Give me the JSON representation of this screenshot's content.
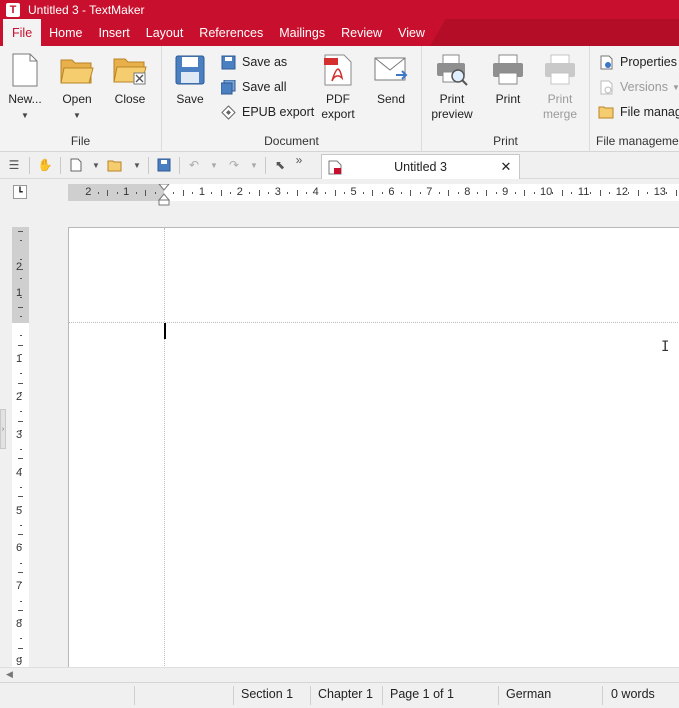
{
  "window": {
    "title": "Untitled 3 - TextMaker",
    "logo_letter": "T"
  },
  "menu_tabs": [
    "File",
    "Home",
    "Insert",
    "Layout",
    "References",
    "Mailings",
    "Review",
    "View"
  ],
  "ribbon": {
    "file": {
      "label": "File",
      "new": "New...",
      "open": "Open",
      "close": "Close"
    },
    "document": {
      "label": "Document",
      "save": "Save",
      "save_as": "Save as",
      "save_all": "Save all",
      "epub_export": "EPUB export",
      "pdf_export": "PDF\nexport",
      "send": "Send"
    },
    "print": {
      "label": "Print",
      "print_preview": "Print\npreview",
      "print": "Print",
      "print_merge": "Print\nmerge"
    },
    "file_management": {
      "label": "File management",
      "properties": "Properties",
      "versions": "Versions",
      "file_manager": "File manag"
    }
  },
  "doc_tab": {
    "label": "Untitled 3",
    "close": "✕"
  },
  "ruler": {
    "h_numbers": [
      "2",
      "1",
      "1",
      "2",
      "3",
      "4",
      "5",
      "6",
      "7",
      "8",
      "9",
      "10",
      "11",
      "12",
      "13"
    ],
    "v_numbers": [
      "2",
      "1",
      "1",
      "2",
      "3",
      "4",
      "5",
      "6",
      "7",
      "8",
      "9"
    ]
  },
  "status": {
    "section": "Section 1",
    "chapter": "Chapter 1",
    "page": "Page 1 of 1",
    "language": "German",
    "words": "0 words"
  },
  "colors": {
    "accent": "#c8102e"
  }
}
